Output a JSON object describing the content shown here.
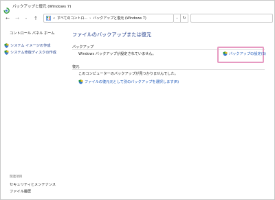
{
  "window": {
    "title": "バックアップと復元 (Windows 7)"
  },
  "nav": {
    "back_icon": "arrow-left-icon",
    "forward_icon": "arrow-right-icon",
    "recent_icon": "chevron-down-icon",
    "up_icon": "arrow-up-icon"
  },
  "address": {
    "overflow": "«",
    "crumb_1": "すべてのコントロ...",
    "separator": "›",
    "crumb_2": "バックアップと復元 (Windows 7)"
  },
  "search": {
    "placeholder": ""
  },
  "sidebar": {
    "home": "コントロール パネル ホーム",
    "tasks": [
      {
        "label": "システム イメージの作成"
      },
      {
        "label": "システム修復ディスクの作成"
      }
    ],
    "related_heading": "関連項目",
    "related": [
      {
        "label": "セキュリティとメンテナンス"
      },
      {
        "label": "ファイル履歴"
      }
    ]
  },
  "main": {
    "title": "ファイルのバックアップまたは復元",
    "backup": {
      "heading": "バックアップ",
      "status": "Windows バックアップが設定されていません。",
      "setup_link": "バックアップの設定(S)"
    },
    "restore": {
      "heading": "復元",
      "status": "このコンピューターのバックアップが見つかりませんでした。",
      "select_link": "ファイルの復元元として別のバックアップを選択します(R)"
    }
  },
  "colors": {
    "title_blue": "#1e3b8a",
    "link_blue": "#1a56b8",
    "highlight_pink": "#e79ac2"
  }
}
